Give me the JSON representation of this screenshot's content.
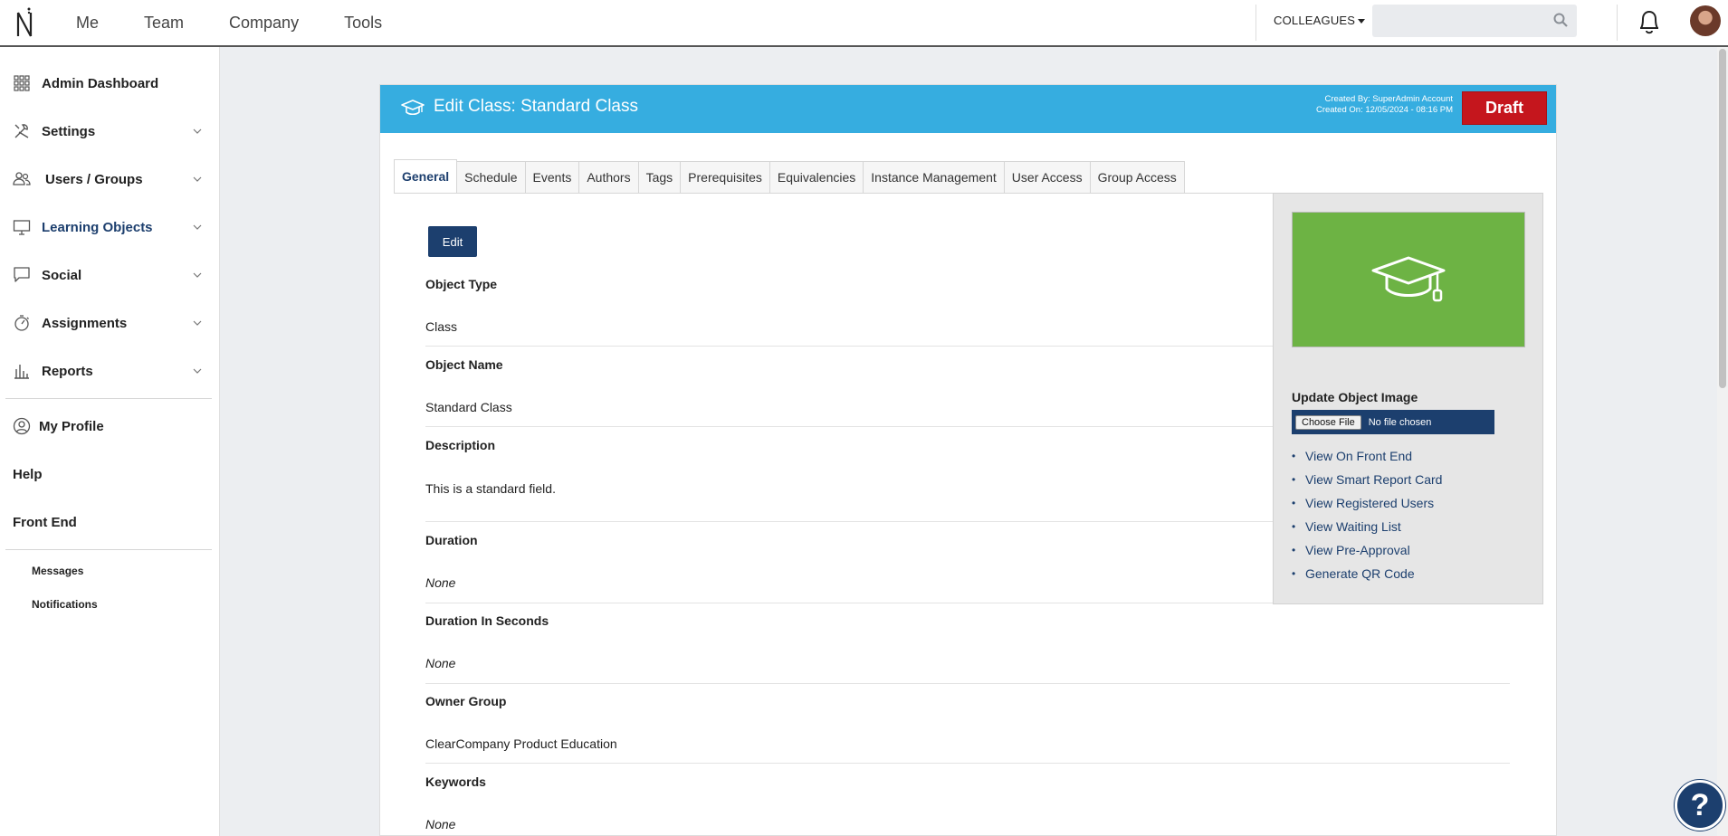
{
  "topnav": {
    "items": [
      "Me",
      "Team",
      "Company",
      "Tools"
    ],
    "colleagues_label": "COLLEAGUES",
    "search_placeholder": ""
  },
  "sidebar": {
    "items": [
      {
        "label": "Admin Dashboard",
        "icon": "grid-icon",
        "chevron": false
      },
      {
        "label": "Settings",
        "icon": "tools-icon",
        "chevron": true
      },
      {
        "label": "Users / Groups",
        "icon": "users-icon",
        "chevron": true
      },
      {
        "label": "Learning Objects",
        "icon": "monitor-icon",
        "chevron": true,
        "active": true
      },
      {
        "label": "Social",
        "icon": "chat-icon",
        "chevron": true
      },
      {
        "label": "Assignments",
        "icon": "stopwatch-icon",
        "chevron": true
      },
      {
        "label": "Reports",
        "icon": "bar-chart-icon",
        "chevron": true
      }
    ],
    "my_profile": "My Profile",
    "help": "Help",
    "front_end": "Front End",
    "messages": "Messages",
    "notifications": "Notifications"
  },
  "card": {
    "title": "Edit Class: Standard Class",
    "created_by": "Created By: SuperAdmin Account",
    "created_on": "Created On: 12/05/2024 - 08:16 PM",
    "status": "Draft",
    "tabs": [
      "General",
      "Schedule",
      "Events",
      "Authors",
      "Tags",
      "Prerequisites",
      "Equivalencies",
      "Instance Management",
      "User Access",
      "Group Access"
    ],
    "active_tab": "General",
    "edit_label": "Edit",
    "fields": [
      {
        "label": "Object Type",
        "value": "Class"
      },
      {
        "label": "Object Name",
        "value": "Standard Class"
      },
      {
        "label": "Description",
        "value": "This is a standard field."
      },
      {
        "label": "Duration",
        "value": "None"
      },
      {
        "label": "Duration In Seconds",
        "value": "None"
      },
      {
        "label": "Owner Group",
        "value": "ClearCompany Product Education"
      },
      {
        "label": "Keywords",
        "value": "None"
      }
    ]
  },
  "panel": {
    "update_image_label": "Update Object Image",
    "choose_file": "Choose File",
    "no_file": "No file chosen",
    "links": [
      "View On Front End",
      "View Smart Report Card",
      "View Registered Users",
      "View Waiting List",
      "View Pre-Approval",
      "Generate QR Code"
    ]
  },
  "help_fab": "?",
  "colors": {
    "header_blue": "#36ade0",
    "navy": "#1c3f6e",
    "draft_red": "#c5161d",
    "thumb_green": "#6db344"
  }
}
